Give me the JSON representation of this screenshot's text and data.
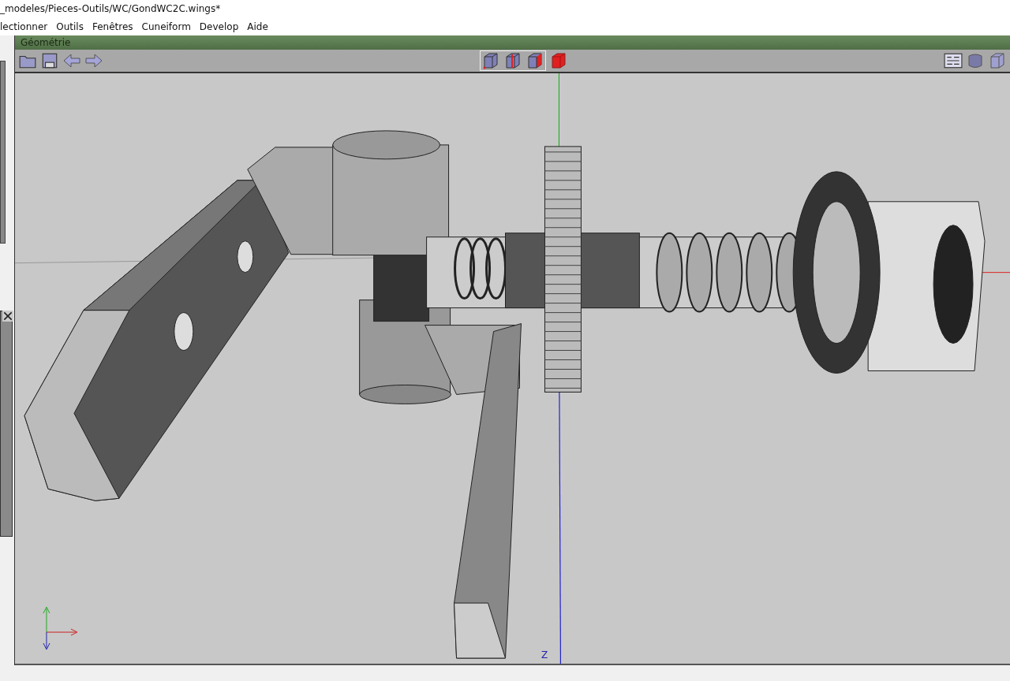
{
  "window": {
    "title": "_modeles/Pieces-Outils/WC/GondWC2C.wings*"
  },
  "menu": [
    "lectionner",
    "Outils",
    "Fenêtres",
    "Cuneiform",
    "Develop",
    "Aide"
  ],
  "geometry_window": {
    "title": "Géométrie",
    "axis_label": "Z"
  }
}
